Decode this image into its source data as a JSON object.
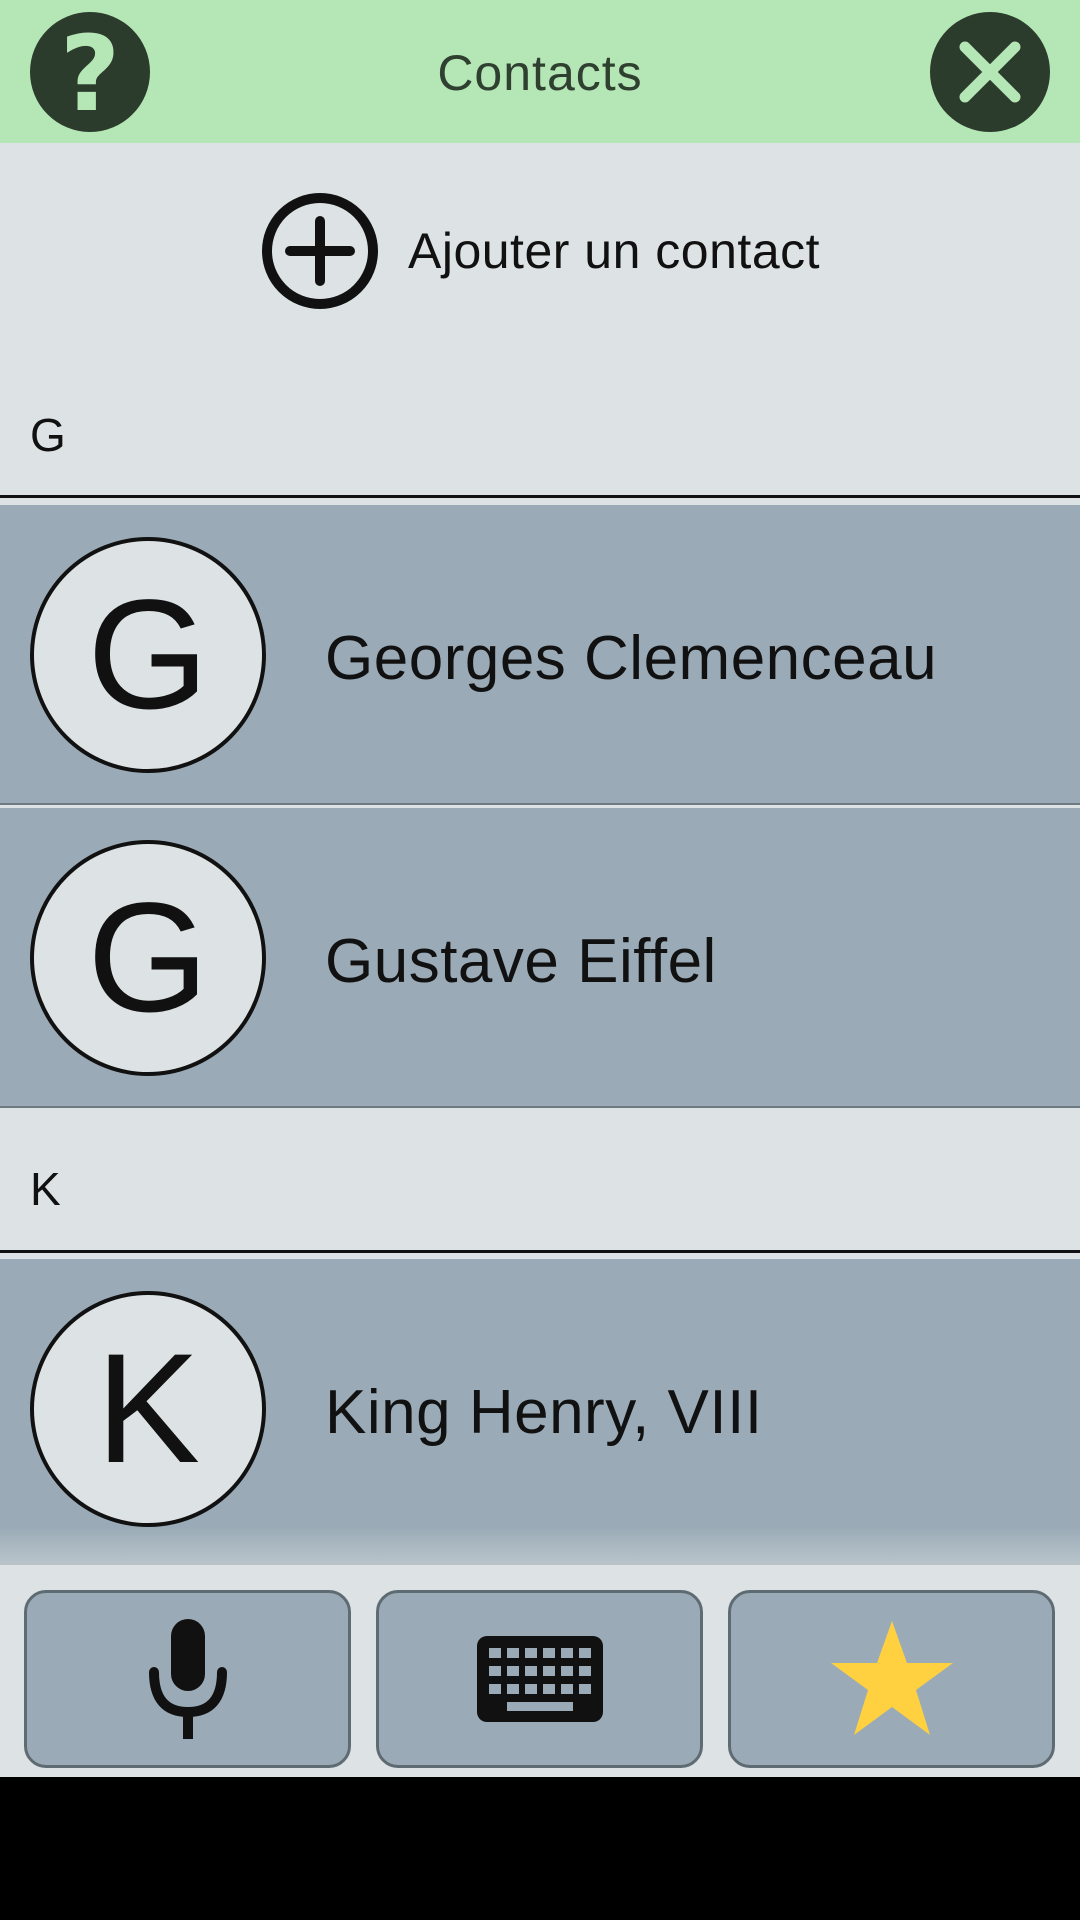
{
  "header": {
    "title": "Contacts",
    "help_symbol": "?",
    "help_icon": "question-mark-icon",
    "close_icon": "close-icon",
    "background_color": "#b5e6b5",
    "button_color": "#2b3b2c"
  },
  "add_contact": {
    "label": "Ajouter un contact",
    "icon": "plus-circle-icon"
  },
  "sections": [
    {
      "letter": "G",
      "contacts": [
        {
          "initial": "G",
          "name": "Georges Clemenceau"
        },
        {
          "initial": "G",
          "name": "Gustave Eiffel"
        }
      ]
    },
    {
      "letter": "K",
      "contacts": [
        {
          "initial": "K",
          "name": "King Henry, VIII"
        }
      ]
    }
  ],
  "toolbar": {
    "buttons": [
      {
        "icon": "microphone-icon"
      },
      {
        "icon": "keyboard-icon"
      },
      {
        "icon": "star-icon",
        "color": "#ffd03f"
      }
    ]
  },
  "colors": {
    "row_background": "#9aabb7",
    "page_background": "#dde3e4"
  }
}
